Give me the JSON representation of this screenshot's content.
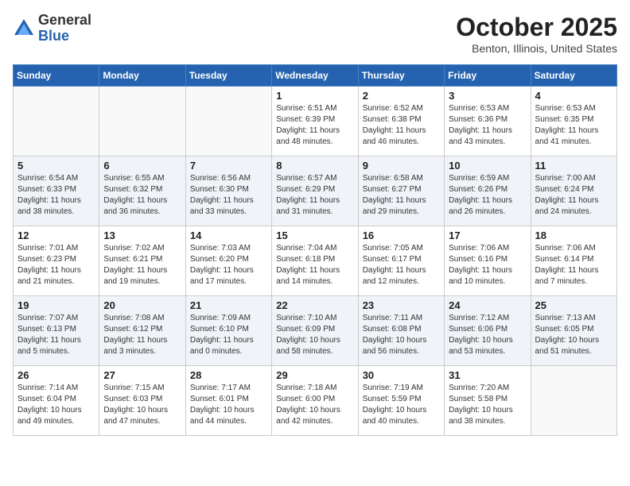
{
  "header": {
    "logo_general": "General",
    "logo_blue": "Blue",
    "month_title": "October 2025",
    "location": "Benton, Illinois, United States"
  },
  "days_of_week": [
    "Sunday",
    "Monday",
    "Tuesday",
    "Wednesday",
    "Thursday",
    "Friday",
    "Saturday"
  ],
  "weeks": [
    [
      {
        "day": "",
        "info": ""
      },
      {
        "day": "",
        "info": ""
      },
      {
        "day": "",
        "info": ""
      },
      {
        "day": "1",
        "info": "Sunrise: 6:51 AM\nSunset: 6:39 PM\nDaylight: 11 hours\nand 48 minutes."
      },
      {
        "day": "2",
        "info": "Sunrise: 6:52 AM\nSunset: 6:38 PM\nDaylight: 11 hours\nand 46 minutes."
      },
      {
        "day": "3",
        "info": "Sunrise: 6:53 AM\nSunset: 6:36 PM\nDaylight: 11 hours\nand 43 minutes."
      },
      {
        "day": "4",
        "info": "Sunrise: 6:53 AM\nSunset: 6:35 PM\nDaylight: 11 hours\nand 41 minutes."
      }
    ],
    [
      {
        "day": "5",
        "info": "Sunrise: 6:54 AM\nSunset: 6:33 PM\nDaylight: 11 hours\nand 38 minutes."
      },
      {
        "day": "6",
        "info": "Sunrise: 6:55 AM\nSunset: 6:32 PM\nDaylight: 11 hours\nand 36 minutes."
      },
      {
        "day": "7",
        "info": "Sunrise: 6:56 AM\nSunset: 6:30 PM\nDaylight: 11 hours\nand 33 minutes."
      },
      {
        "day": "8",
        "info": "Sunrise: 6:57 AM\nSunset: 6:29 PM\nDaylight: 11 hours\nand 31 minutes."
      },
      {
        "day": "9",
        "info": "Sunrise: 6:58 AM\nSunset: 6:27 PM\nDaylight: 11 hours\nand 29 minutes."
      },
      {
        "day": "10",
        "info": "Sunrise: 6:59 AM\nSunset: 6:26 PM\nDaylight: 11 hours\nand 26 minutes."
      },
      {
        "day": "11",
        "info": "Sunrise: 7:00 AM\nSunset: 6:24 PM\nDaylight: 11 hours\nand 24 minutes."
      }
    ],
    [
      {
        "day": "12",
        "info": "Sunrise: 7:01 AM\nSunset: 6:23 PM\nDaylight: 11 hours\nand 21 minutes."
      },
      {
        "day": "13",
        "info": "Sunrise: 7:02 AM\nSunset: 6:21 PM\nDaylight: 11 hours\nand 19 minutes."
      },
      {
        "day": "14",
        "info": "Sunrise: 7:03 AM\nSunset: 6:20 PM\nDaylight: 11 hours\nand 17 minutes."
      },
      {
        "day": "15",
        "info": "Sunrise: 7:04 AM\nSunset: 6:18 PM\nDaylight: 11 hours\nand 14 minutes."
      },
      {
        "day": "16",
        "info": "Sunrise: 7:05 AM\nSunset: 6:17 PM\nDaylight: 11 hours\nand 12 minutes."
      },
      {
        "day": "17",
        "info": "Sunrise: 7:06 AM\nSunset: 6:16 PM\nDaylight: 11 hours\nand 10 minutes."
      },
      {
        "day": "18",
        "info": "Sunrise: 7:06 AM\nSunset: 6:14 PM\nDaylight: 11 hours\nand 7 minutes."
      }
    ],
    [
      {
        "day": "19",
        "info": "Sunrise: 7:07 AM\nSunset: 6:13 PM\nDaylight: 11 hours\nand 5 minutes."
      },
      {
        "day": "20",
        "info": "Sunrise: 7:08 AM\nSunset: 6:12 PM\nDaylight: 11 hours\nand 3 minutes."
      },
      {
        "day": "21",
        "info": "Sunrise: 7:09 AM\nSunset: 6:10 PM\nDaylight: 11 hours\nand 0 minutes."
      },
      {
        "day": "22",
        "info": "Sunrise: 7:10 AM\nSunset: 6:09 PM\nDaylight: 10 hours\nand 58 minutes."
      },
      {
        "day": "23",
        "info": "Sunrise: 7:11 AM\nSunset: 6:08 PM\nDaylight: 10 hours\nand 56 minutes."
      },
      {
        "day": "24",
        "info": "Sunrise: 7:12 AM\nSunset: 6:06 PM\nDaylight: 10 hours\nand 53 minutes."
      },
      {
        "day": "25",
        "info": "Sunrise: 7:13 AM\nSunset: 6:05 PM\nDaylight: 10 hours\nand 51 minutes."
      }
    ],
    [
      {
        "day": "26",
        "info": "Sunrise: 7:14 AM\nSunset: 6:04 PM\nDaylight: 10 hours\nand 49 minutes."
      },
      {
        "day": "27",
        "info": "Sunrise: 7:15 AM\nSunset: 6:03 PM\nDaylight: 10 hours\nand 47 minutes."
      },
      {
        "day": "28",
        "info": "Sunrise: 7:17 AM\nSunset: 6:01 PM\nDaylight: 10 hours\nand 44 minutes."
      },
      {
        "day": "29",
        "info": "Sunrise: 7:18 AM\nSunset: 6:00 PM\nDaylight: 10 hours\nand 42 minutes."
      },
      {
        "day": "30",
        "info": "Sunrise: 7:19 AM\nSunset: 5:59 PM\nDaylight: 10 hours\nand 40 minutes."
      },
      {
        "day": "31",
        "info": "Sunrise: 7:20 AM\nSunset: 5:58 PM\nDaylight: 10 hours\nand 38 minutes."
      },
      {
        "day": "",
        "info": ""
      }
    ]
  ]
}
